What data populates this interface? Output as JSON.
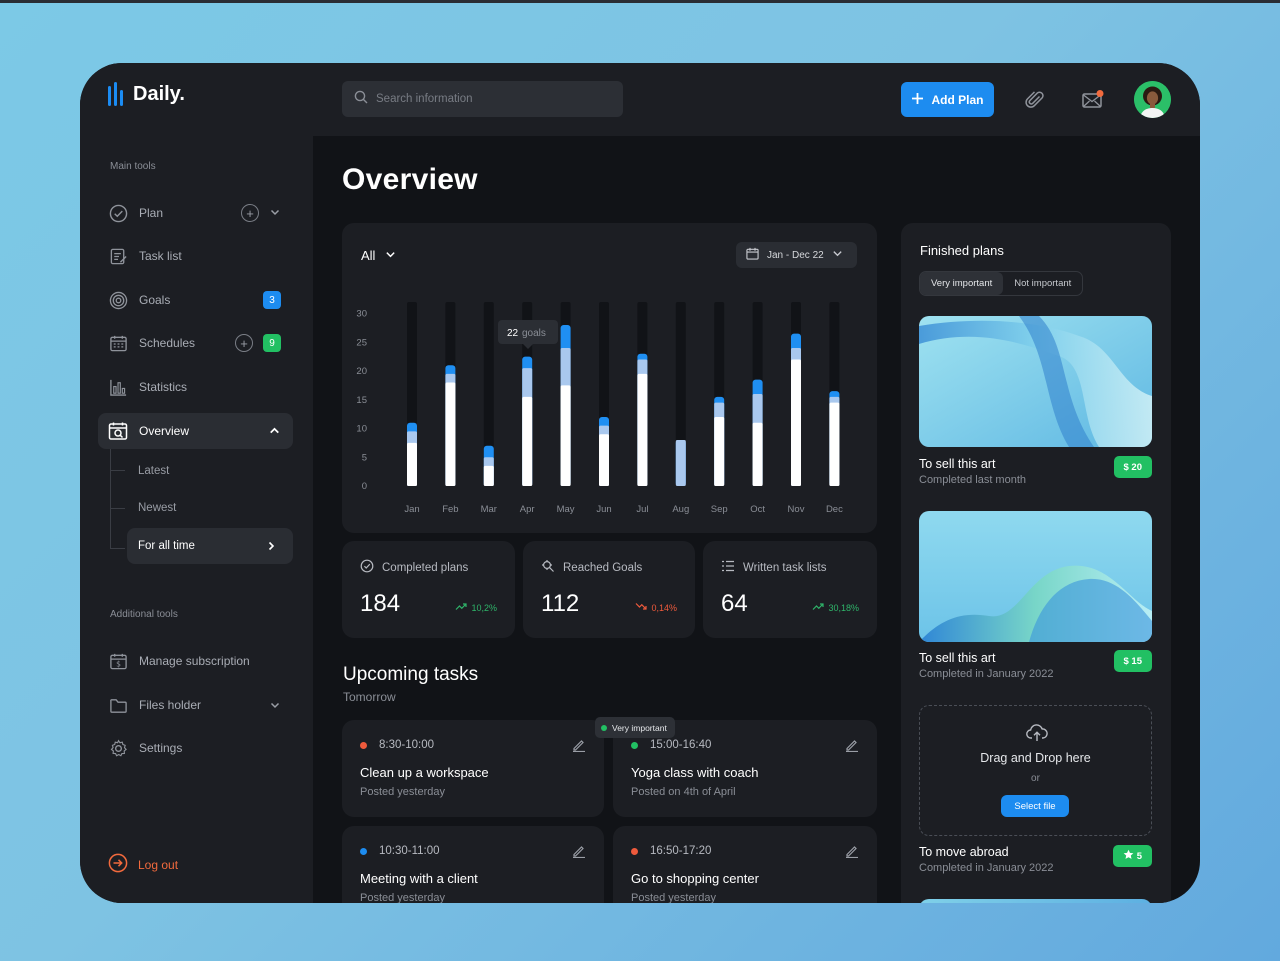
{
  "app": {
    "name": "Daily."
  },
  "search": {
    "placeholder": "Search information"
  },
  "header": {
    "add_plan_label": "Add Plan",
    "icons": [
      "paperclip-icon",
      "mail-icon",
      "avatar"
    ]
  },
  "sidebar": {
    "main_tools_title": "Main tools",
    "items": [
      {
        "label": "Plan",
        "icon": "check-circle-icon"
      },
      {
        "label": "Task list",
        "icon": "task-list-icon"
      },
      {
        "label": "Goals",
        "icon": "target-icon",
        "badge": "3"
      },
      {
        "label": "Schedules",
        "icon": "calendar-icon",
        "badge": "9"
      },
      {
        "label": "Statistics",
        "icon": "bar-chart-icon"
      },
      {
        "label": "Overview",
        "icon": "overview-icon"
      }
    ],
    "sub_items": [
      {
        "label": "Latest"
      },
      {
        "label": "Newest"
      },
      {
        "label": "For all time"
      }
    ],
    "additional_tools_title": "Additional tools",
    "additional_items": [
      {
        "label": "Manage subscription",
        "icon": "subscription-icon"
      },
      {
        "label": "Files holder",
        "icon": "folder-icon"
      },
      {
        "label": "Settings",
        "icon": "gear-icon"
      }
    ],
    "logout_label": "Log out",
    "colors": {
      "blue_badge": "#1d8cf0",
      "green_badge": "#22c063",
      "logout": "#f26a3d"
    }
  },
  "main": {
    "title": "Overview",
    "filter_label": "All",
    "date_range": "Jan - Dec 22",
    "tooltip": {
      "value": "22",
      "label": "goals"
    }
  },
  "chart_data": {
    "type": "bar",
    "categories": [
      "Jan",
      "Feb",
      "Mar",
      "Apr",
      "May",
      "Jun",
      "Jul",
      "Aug",
      "Sep",
      "Oct",
      "Nov",
      "Dec"
    ],
    "series": [
      {
        "values": [
          7.5,
          18.0,
          3.5,
          15.5,
          17.5,
          9.0,
          19.5,
          0,
          12.0,
          11.0,
          22.0,
          14.5
        ]
      },
      {
        "values": [
          9.5,
          19.5,
          5.0,
          20.5,
          24.0,
          10.5,
          22.0,
          8.0,
          14.5,
          16.0,
          24.0,
          15.5
        ]
      },
      {
        "values": [
          11.0,
          21.0,
          7.0,
          22.5,
          28.0,
          12.0,
          23.0,
          8.0,
          15.5,
          18.5,
          26.5,
          16.5
        ]
      }
    ],
    "ylim": [
      0,
      32
    ],
    "yticks": [
      "30",
      "25",
      "20",
      "15",
      "10",
      "5",
      "0"
    ],
    "colors": [
      "#ffffff",
      "#a9c8ee",
      "#1f8ff2"
    ],
    "track_color": "#111317",
    "grid": false
  },
  "stats": [
    {
      "label": "Completed plans",
      "value": "184",
      "change": "10,2%",
      "direction": "up",
      "icon": "check-circle-icon"
    },
    {
      "label": "Reached Goals",
      "value": "112",
      "change": "0,14%",
      "direction": "down",
      "icon": "goal-search-icon"
    },
    {
      "label": "Written task lists",
      "value": "64",
      "change": "30,18%",
      "direction": "up",
      "icon": "list-icon"
    }
  ],
  "upcoming": {
    "title": "Upcoming tasks",
    "subtitle": "Tomorrow",
    "important_tag": "Very important",
    "tasks": [
      {
        "time": "8:30-10:00",
        "title": "Clean up a workspace",
        "posted": "Posted yesterday",
        "dot_color": "#ee5a3c"
      },
      {
        "time": "15:00-16:40",
        "title": "Yoga class with coach",
        "posted": "Posted on 4th of April",
        "dot_color": "#22c063"
      },
      {
        "time": "10:30-11:00",
        "title": "Meeting with a client",
        "posted": "Posted yesterday",
        "dot_color": "#1d8cf0"
      },
      {
        "time": "16:50-17:20",
        "title": "Go to shopping center",
        "posted": "Posted yesterday",
        "dot_color": "#ee5a3c"
      }
    ]
  },
  "finished": {
    "title": "Finished plans",
    "tabs": [
      "Very important",
      "Not important"
    ],
    "plans": [
      {
        "name": "To sell this art",
        "sub": "Completed last month",
        "price": "$ 20"
      },
      {
        "name": "To sell this art",
        "sub": "Completed in January 2022",
        "price": "$ 15"
      },
      {
        "name": "To move abroad",
        "sub": "Completed in January 2022",
        "price": "5"
      }
    ],
    "dropzone": {
      "title": "Drag and Drop here",
      "or": "or",
      "button": "Select file"
    }
  }
}
